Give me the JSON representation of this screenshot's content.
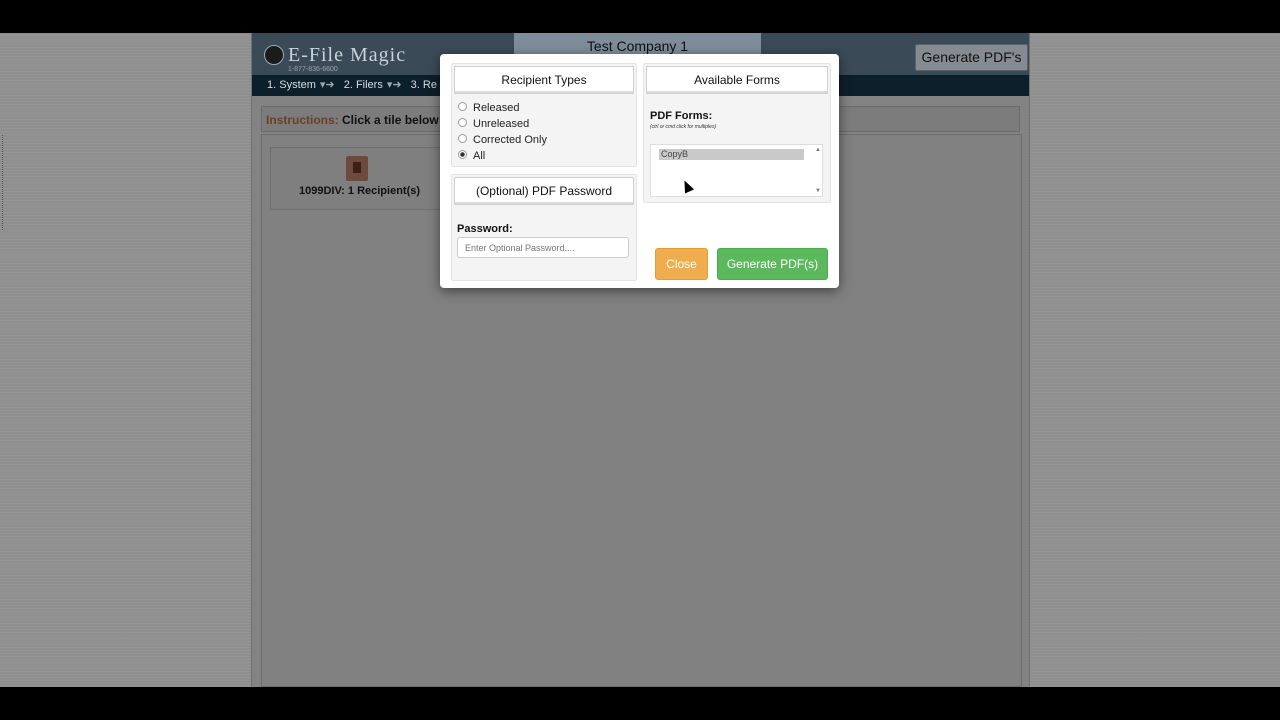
{
  "header": {
    "logo_text": "E-File Magic",
    "logo_phone": "1-877-836-6600",
    "company_name": "Test Company 1",
    "generate_button": "Generate PDF's"
  },
  "steps": [
    {
      "label": "1. System"
    },
    {
      "label": "2. Filers"
    },
    {
      "label": "3. Re"
    }
  ],
  "instructions": {
    "label": "Instructions:",
    "text": "Click a tile below"
  },
  "tile": {
    "label": "1099DIV: 1 Recipient(s)",
    "icon": "pdf-document-icon"
  },
  "modal": {
    "recipient_types": {
      "title": "Recipient Types",
      "options": [
        {
          "label": "Released",
          "selected": false
        },
        {
          "label": "Unreleased",
          "selected": false
        },
        {
          "label": "Corrected Only",
          "selected": false
        },
        {
          "label": "All",
          "selected": true
        }
      ]
    },
    "password_panel": {
      "title": "(Optional) PDF Password",
      "field_label": "Password:",
      "placeholder": "Enter Optional Password...."
    },
    "forms_panel": {
      "title": "Available Forms",
      "field_label": "PDF Forms:",
      "hint": "(ctrl or cmd click for multiples)",
      "options": [
        "CopyB"
      ]
    },
    "close_button": "Close",
    "generate_button": "Generate PDF(s)"
  },
  "colors": {
    "close_button": "#efad4d",
    "generate_button": "#5cb85c",
    "header_bg": "#3b4a57",
    "steps_bg": "#0d1f2b"
  }
}
